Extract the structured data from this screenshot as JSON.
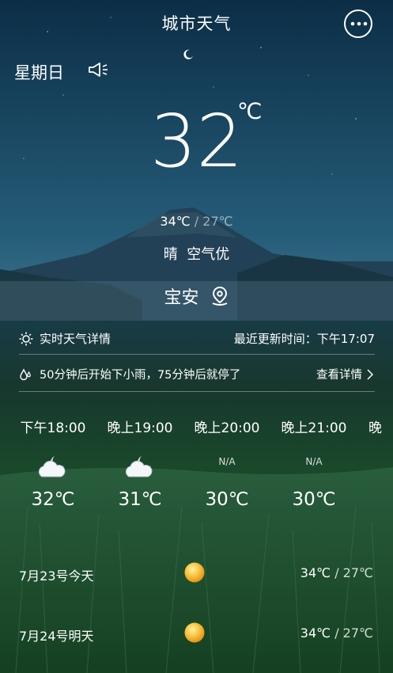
{
  "app": {
    "title": "城市天气"
  },
  "header": {
    "weekday": "星期日"
  },
  "current": {
    "temperature": "32",
    "unit": "℃",
    "high": "34℃",
    "slash": " / ",
    "low": "27℃",
    "condition": "晴",
    "air_quality": "空气优",
    "city": "宝安"
  },
  "info": {
    "realtime_label": "实时天气详情",
    "updated_label": "最近更新时间：下午17:07",
    "rain_forecast": "50分钟后开始下小雨，75分钟后就停了",
    "view_details": "查看详情"
  },
  "hourly": [
    {
      "time": "下午18:00",
      "icon": "partly-cloudy-night-icon",
      "na": "",
      "temp": "32℃"
    },
    {
      "time": "晚上19:00",
      "icon": "partly-cloudy-night-icon",
      "na": "",
      "temp": "31℃"
    },
    {
      "time": "晚上20:00",
      "icon": "",
      "na": "N/A",
      "temp": "30℃"
    },
    {
      "time": "晚上21:00",
      "icon": "",
      "na": "N/A",
      "temp": "30℃"
    },
    {
      "time": "晚",
      "icon": "",
      "na": "",
      "temp": ""
    }
  ],
  "daily": [
    {
      "label": "7月23号今天",
      "icon": "sun-icon",
      "high": "34℃",
      "low": "27℃"
    },
    {
      "label": "7月24号明天",
      "icon": "sun-icon",
      "high": "34℃",
      "low": "27℃"
    }
  ],
  "colors": {
    "sun": "#f5a623"
  }
}
